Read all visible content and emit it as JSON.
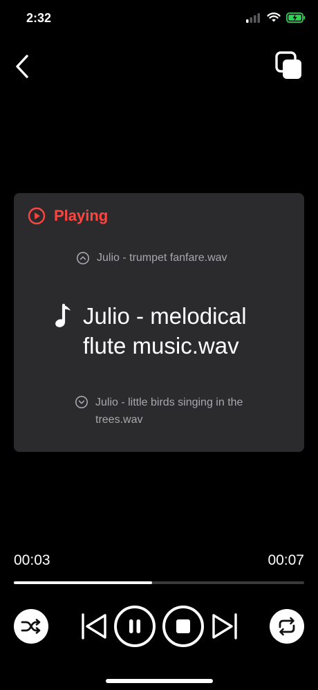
{
  "status_bar": {
    "time": "2:32"
  },
  "player": {
    "state_label": "Playing",
    "previous_track": "Julio - trumpet fanfare.wav",
    "current_track": "Julio - melodical flute music.wav",
    "next_track": "Julio - little birds singing in the trees.wav",
    "elapsed": "00:03",
    "duration": "00:07",
    "progress": 0.476
  },
  "colors": {
    "accent": "#ff4540",
    "card_bg": "#2b2b2d",
    "secondary_text": "#a8a8ad"
  },
  "icons": {
    "back": "chevron-left-icon",
    "copy": "copy-icon",
    "playing": "play-circle-icon",
    "previous": "chevron-up-circle-icon",
    "current": "music-note-icon",
    "next": "chevron-down-circle-icon",
    "shuffle": "shuffle-icon",
    "skip_back": "skip-back-icon",
    "pause": "pause-icon",
    "stop": "stop-icon",
    "skip_forward": "skip-forward-icon",
    "repeat": "repeat-icon"
  }
}
